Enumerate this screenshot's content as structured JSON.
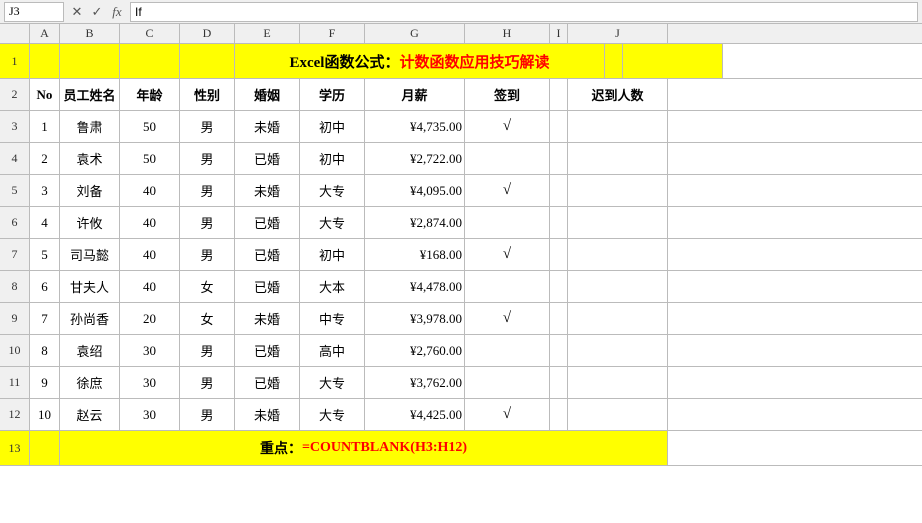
{
  "formula_bar": {
    "cell_ref": "J3",
    "formula_text": "If"
  },
  "columns": [
    "A",
    "B",
    "C",
    "D",
    "E",
    "F",
    "G",
    "H",
    "I",
    "J"
  ],
  "title": {
    "text": "Excel函数公式：",
    "red_text": "计数函数应用技巧解读"
  },
  "header_row": {
    "cells": [
      "No",
      "员工姓名",
      "年龄",
      "性别",
      "婚姻",
      "学历",
      "月薪",
      "签到",
      "",
      "迟到人数"
    ]
  },
  "data_rows": [
    {
      "no": "1",
      "name": "鲁肃",
      "age": "50",
      "gender": "男",
      "marriage": "未婚",
      "edu": "初中",
      "salary": "¥4,735.00",
      "checkin": "√",
      "late": ""
    },
    {
      "no": "2",
      "name": "袁术",
      "age": "50",
      "gender": "男",
      "marriage": "已婚",
      "edu": "初中",
      "salary": "¥2,722.00",
      "checkin": "",
      "late": ""
    },
    {
      "no": "3",
      "name": "刘备",
      "age": "40",
      "gender": "男",
      "marriage": "未婚",
      "edu": "大专",
      "salary": "¥4,095.00",
      "checkin": "√",
      "late": ""
    },
    {
      "no": "4",
      "name": "许攸",
      "age": "40",
      "gender": "男",
      "marriage": "已婚",
      "edu": "大专",
      "salary": "¥2,874.00",
      "checkin": "",
      "late": ""
    },
    {
      "no": "5",
      "name": "司马懿",
      "age": "40",
      "gender": "男",
      "marriage": "已婚",
      "edu": "初中",
      "salary": "¥168.00",
      "checkin": "√",
      "late": ""
    },
    {
      "no": "6",
      "name": "甘夫人",
      "age": "40",
      "gender": "女",
      "marriage": "已婚",
      "edu": "大本",
      "salary": "¥4,478.00",
      "checkin": "",
      "late": ""
    },
    {
      "no": "7",
      "name": "孙尚香",
      "age": "20",
      "gender": "女",
      "marriage": "未婚",
      "edu": "中专",
      "salary": "¥3,978.00",
      "checkin": "√",
      "late": ""
    },
    {
      "no": "8",
      "name": "袁绍",
      "age": "30",
      "gender": "男",
      "marriage": "已婚",
      "edu": "高中",
      "salary": "¥2,760.00",
      "checkin": "",
      "late": ""
    },
    {
      "no": "9",
      "name": "徐庶",
      "age": "30",
      "gender": "男",
      "marriage": "已婚",
      "edu": "大专",
      "salary": "¥3,762.00",
      "checkin": "",
      "late": ""
    },
    {
      "no": "10",
      "name": "赵云",
      "age": "30",
      "gender": "男",
      "marriage": "未婚",
      "edu": "大专",
      "salary": "¥4,425.00",
      "checkin": "√",
      "late": ""
    }
  ],
  "note": {
    "label": "重点：",
    "formula": "=COUNTBLANK(H3:H12)"
  },
  "row_numbers": [
    "1",
    "2",
    "3",
    "4",
    "5",
    "6",
    "7",
    "8",
    "9",
    "10",
    "11",
    "12",
    "13"
  ],
  "col_labels": [
    "A",
    "B",
    "C",
    "D",
    "E",
    "F",
    "G",
    "H",
    "I",
    "J"
  ]
}
